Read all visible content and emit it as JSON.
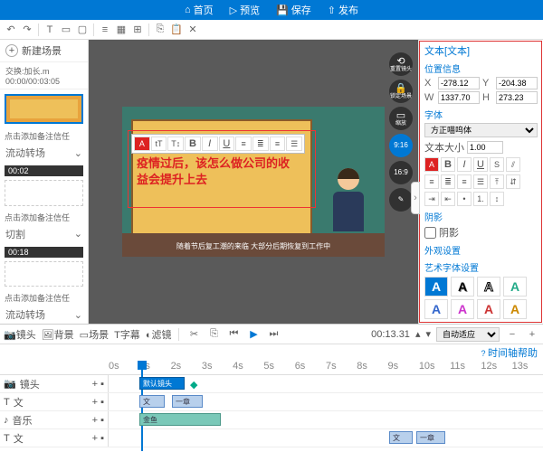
{
  "topbar": {
    "home": "首页",
    "preview": "预览",
    "save": "保存",
    "publish": "发布"
  },
  "left": {
    "newscene": "新建场景",
    "timecode": "交换:加长.m 00:00/00:03:05",
    "caption": "点击添加备注信任",
    "flow": "流动转场",
    "cut": "切割",
    "t1": "00:02",
    "t2": "00:18"
  },
  "canvas": {
    "text": "疫情过后，该怎么做公司的收益会提升上去",
    "caption": "随着节后复工潮的来临 大部分后期恢复到工作中"
  },
  "rfloat": {
    "reset": "重置镜头",
    "lock": "锁定场景",
    "zoom": "缩放",
    "zval": "9:16",
    "r2": "16:9"
  },
  "right": {
    "title": "文本[文本]",
    "sect_pos": "位置信息",
    "x": "-278.12",
    "y": "-204.38",
    "w": "1337.70",
    "h": "273.23",
    "sect_font": "字体",
    "font": "方正喵呜体",
    "sizelbl": "文本大小",
    "size": "1.00",
    "shadow": "阴影",
    "outline": "外观设置",
    "artfont": "艺术字体设置"
  },
  "bottom": {
    "lens": "镜头",
    "bg": "背景",
    "scene": "场景",
    "subtitle": "字幕",
    "filter": "滤镜",
    "time": "00:13.31",
    "autofit": "自动适应",
    "helplink": "时间轴帮助",
    "tracks": {
      "lens": "镜头",
      "text": "文",
      "audio": "音乐",
      "sub": "文"
    },
    "clip_lens": "默认镜头",
    "clip_t1": "文",
    "clip_t2": "一章",
    "clip_a": "金鱼"
  },
  "ruler": [
    "0s",
    "1s",
    "2s",
    "3s",
    "4s",
    "5s",
    "6s",
    "7s",
    "8s",
    "9s",
    "10s",
    "11s",
    "12s",
    "13s"
  ]
}
